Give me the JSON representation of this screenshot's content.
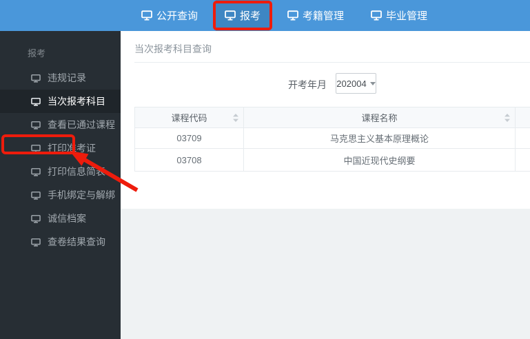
{
  "topnav": {
    "items": [
      {
        "label": "公开查询",
        "active": false
      },
      {
        "label": "报考",
        "active": true,
        "annotated": true
      },
      {
        "label": "考籍管理",
        "active": false
      },
      {
        "label": "毕业管理",
        "active": false
      }
    ]
  },
  "sidebar": {
    "section_label": "报考",
    "items": [
      {
        "label": "违规记录",
        "active": false
      },
      {
        "label": "当次报考科目",
        "active": true
      },
      {
        "label": "查看已通过课程",
        "active": false
      },
      {
        "label": "打印准考证",
        "active": false,
        "annotated": true
      },
      {
        "label": "打印信息简表",
        "active": false
      },
      {
        "label": "手机绑定与解绑",
        "active": false
      },
      {
        "label": "诚信档案",
        "active": false
      },
      {
        "label": "查卷结果查询",
        "active": false
      }
    ]
  },
  "main": {
    "title": "当次报考科目查询",
    "filter": {
      "label": "开考年月",
      "value": "202004"
    },
    "table": {
      "columns": [
        "课程代码",
        "课程名称"
      ],
      "rows": [
        [
          "03709",
          "马克思主义基本原理概论"
        ],
        [
          "03708",
          "中国近现代史纲要"
        ]
      ]
    }
  },
  "icons": {
    "nav_item": "monitor-icon",
    "sort": "sort-icon",
    "select": "caret-down-icon"
  },
  "colors": {
    "topbar_blue": "#4a97da",
    "topbar_active_blue": "#3e86c3",
    "sidebar_dark": "#272e34",
    "annotation_red": "#ee1c0c",
    "content_gray_bg": "#eff2f3",
    "table_header_bg": "#f7f9fb",
    "table_border": "#e7ebee"
  }
}
